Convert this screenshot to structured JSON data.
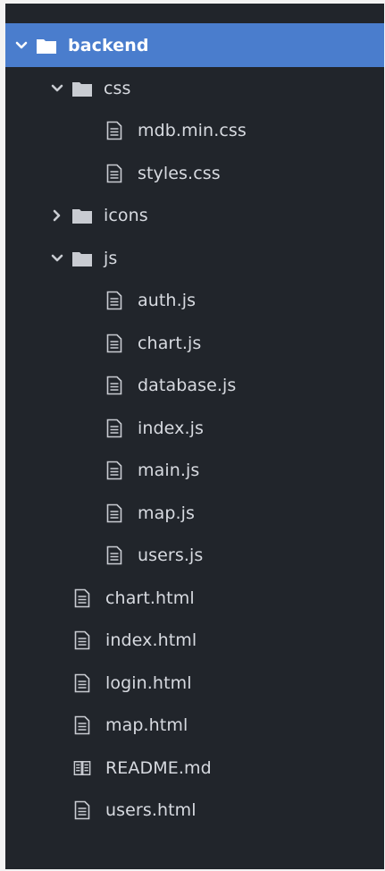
{
  "colors": {
    "panel_bg": "#21252b",
    "selected_bg": "#4a7dcd",
    "text": "#d7dae0",
    "icon": "#c9ccd2"
  },
  "tree": {
    "root": {
      "label": "backend",
      "expanded": true,
      "icon": "folder-icon"
    },
    "css": {
      "label": "css",
      "expanded": true,
      "files": [
        "mdb.min.css",
        "styles.css"
      ]
    },
    "icons": {
      "label": "icons",
      "expanded": false
    },
    "js": {
      "label": "js",
      "expanded": true,
      "files": [
        "auth.js",
        "chart.js",
        "database.js",
        "index.js",
        "main.js",
        "map.js",
        "users.js"
      ]
    },
    "files": [
      "chart.html",
      "index.html",
      "login.html",
      "map.html",
      "README.md",
      "users.html"
    ]
  }
}
